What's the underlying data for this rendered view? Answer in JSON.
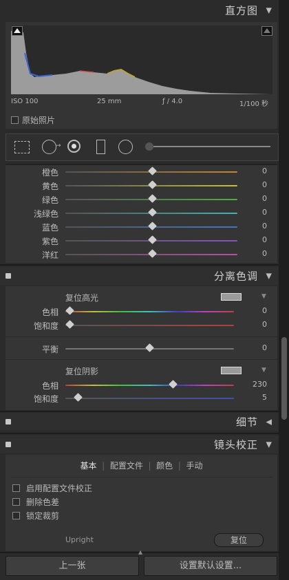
{
  "histogram": {
    "title": "直方图",
    "meta": {
      "iso": "ISO 100",
      "focal": "25 mm",
      "aperture": "ƒ / 4.0",
      "shutter": "1/100 秒"
    },
    "original_photo_label": "原始照片"
  },
  "hsl": {
    "rows": [
      {
        "label": "橙色",
        "value": "0",
        "color": "#c8862f"
      },
      {
        "label": "黄色",
        "value": "0",
        "color": "#c9c23a"
      },
      {
        "label": "绿色",
        "value": "0",
        "color": "#4fae45"
      },
      {
        "label": "浅绿色",
        "value": "0",
        "color": "#45b3b3"
      },
      {
        "label": "蓝色",
        "value": "0",
        "color": "#3f78c8"
      },
      {
        "label": "紫色",
        "value": "0",
        "color": "#8a52c0"
      },
      {
        "label": "洋红",
        "value": "0",
        "color": "#b84fa6"
      }
    ]
  },
  "split_toning": {
    "title": "分离色调",
    "highlights": {
      "label": "复位高光",
      "hue_label": "色相",
      "hue_value": "0",
      "sat_label": "饱和度",
      "sat_value": "0"
    },
    "balance": {
      "label": "平衡",
      "value": "0"
    },
    "shadows": {
      "label": "复位阴影",
      "hue_label": "色相",
      "hue_value": "230",
      "sat_label": "饱和度",
      "sat_value": "5"
    }
  },
  "detail": {
    "title": "细节"
  },
  "lens": {
    "title": "镜头校正",
    "tabs": [
      "基本",
      "配置文件",
      "颜色",
      "手动"
    ],
    "options": [
      "启用配置文件校正",
      "删除色差",
      "锁定裁剪"
    ],
    "upright_label": "Upright",
    "reset_label": "复位"
  },
  "footer": {
    "prev_label": "上一张",
    "default_label": "设置默认设置..."
  }
}
